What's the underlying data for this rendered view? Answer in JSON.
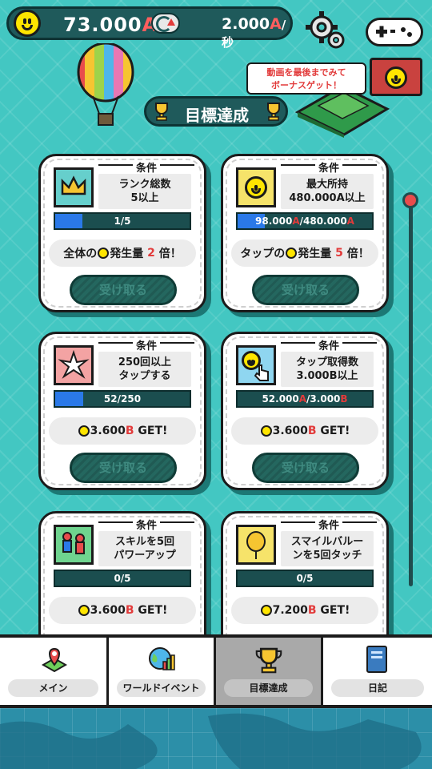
{
  "header": {
    "currency_amount": "73.000",
    "currency_unit": "A",
    "rate_amount": "2.000",
    "rate_unit": "A",
    "rate_suffix": "/秒"
  },
  "bonus_ad": {
    "text_line1": "動画を最後までみて",
    "text_line2": "ボーナスゲット！"
  },
  "page_title": "目標達成",
  "condition_label": "条件",
  "cards": [
    {
      "condition": "ランク総数\n5以上",
      "progress_text": "1/5",
      "progress": 0.2,
      "reward_pre": "全体の",
      "reward_mid": "発生量",
      "reward_num": "2",
      "reward_post": "倍！",
      "claim_label": "受け取る",
      "icon": "crown-icon"
    },
    {
      "condition": "最大所持\n480.000A以上",
      "progress_text_a": "98.000",
      "progress_unit_a": "A",
      "progress_text_b": "/480.000",
      "progress_unit_b": "A",
      "progress": 0.2,
      "reward_pre": "タップの",
      "reward_mid": "発生量",
      "reward_num": "5",
      "reward_post": "倍！",
      "claim_label": "受け取る",
      "icon": "smiley-icon"
    },
    {
      "condition": "250回以上\nタップする",
      "progress_text": "52/250",
      "progress": 0.21,
      "reward_amount": "3.600",
      "reward_unit": "B",
      "reward_get": "GET!",
      "claim_label": "受け取る",
      "icon": "tap-burst-icon"
    },
    {
      "condition": "タップ取得数\n3.000B以上",
      "progress_text_a": "52.000",
      "progress_unit_a": "A",
      "progress_text_b": "/3.000",
      "progress_unit_b": "B",
      "progress": 0.0,
      "reward_amount": "3.600",
      "reward_unit": "B",
      "reward_get": "GET!",
      "claim_label": "受け取る",
      "icon": "tap-smiley-icon"
    },
    {
      "condition": "スキルを5回\nパワーアップ",
      "progress_text": "0/5",
      "progress": 0.0,
      "reward_amount": "3.600",
      "reward_unit": "B",
      "reward_get": "GET!",
      "icon": "skill-figures-icon"
    },
    {
      "condition": "スマイルバルー\nンを5回タッチ",
      "progress_text": "0/5",
      "progress": 0.0,
      "reward_amount": "7.200",
      "reward_unit": "B",
      "reward_get": "GET!",
      "icon": "smile-balloon-icon"
    }
  ],
  "nav": [
    {
      "label": "メイン",
      "icon": "map-pin-icon",
      "active": false
    },
    {
      "label": "ワールドイベント",
      "icon": "globe-chart-icon",
      "active": false
    },
    {
      "label": "目標達成",
      "icon": "trophy-icon",
      "active": true
    },
    {
      "label": "日記",
      "icon": "diary-icon",
      "active": false
    }
  ],
  "colors": {
    "background": "#43c7c2",
    "accent_red": "#e23b3b",
    "progress_blue": "#2a79e8",
    "dark_teal": "#1f5a5b"
  }
}
